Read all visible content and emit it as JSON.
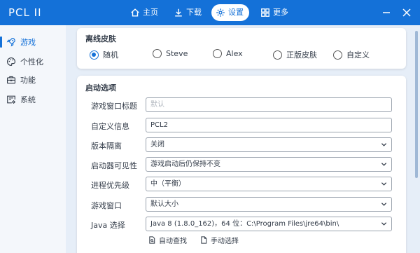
{
  "app": {
    "title": "PCL II"
  },
  "nav": {
    "home": "主页",
    "download": "下载",
    "settings": "设置",
    "more": "更多"
  },
  "sidebar": {
    "items": [
      {
        "label": "游戏",
        "icon": "rocket-icon",
        "active": true
      },
      {
        "label": "个性化",
        "icon": "palette-icon",
        "active": false
      },
      {
        "label": "功能",
        "icon": "toolbox-icon",
        "active": false
      },
      {
        "label": "系统",
        "icon": "system-settings-icon",
        "active": false
      }
    ]
  },
  "offline_skin": {
    "title": "离线皮肤",
    "options": [
      "随机",
      "Steve",
      "Alex",
      "正版皮肤",
      "自定义"
    ],
    "selected": "随机"
  },
  "launch_options": {
    "title": "启动选项",
    "rows": [
      {
        "label": "游戏窗口标题",
        "value": "",
        "placeholder": "默认",
        "type": "text"
      },
      {
        "label": "自定义信息",
        "value": "PCL2",
        "type": "text"
      },
      {
        "label": "版本隔离",
        "value": "关闭",
        "type": "select"
      },
      {
        "label": "启动器可见性",
        "value": "游戏启动后仍保持不变",
        "type": "select"
      },
      {
        "label": "进程优先级",
        "value": "中（平衡）",
        "type": "select"
      },
      {
        "label": "游戏窗口",
        "value": "默认大小",
        "type": "select"
      },
      {
        "label": "Java 选择",
        "value": "Java 8 (1.8.0_162)，64 位：C:\\Program Files\\jre64\\bin\\",
        "type": "select"
      }
    ],
    "auto_find": "自动查找",
    "manual_select": "手动选择"
  },
  "colors": {
    "accent": "#1471d8",
    "background": "#e6eef8",
    "card": "#ffffff"
  }
}
